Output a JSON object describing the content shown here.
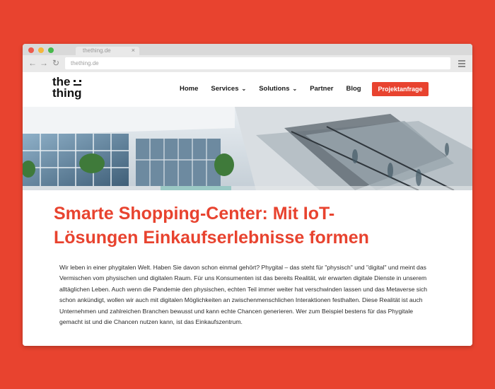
{
  "browser": {
    "tab_title": "thething.de",
    "tab_close": "×",
    "url": "thething.de",
    "back_icon": "←",
    "forward_icon": "→",
    "reload_icon": "↻"
  },
  "site": {
    "logo": {
      "line1": "the",
      "line2": "thing"
    },
    "nav": [
      {
        "label": "Home",
        "has_dropdown": false
      },
      {
        "label": "Services",
        "has_dropdown": true
      },
      {
        "label": "Solutions",
        "has_dropdown": true
      },
      {
        "label": "Partner",
        "has_dropdown": false
      },
      {
        "label": "Blog",
        "has_dropdown": false
      }
    ],
    "dropdown_icon": "⌄",
    "cta_label": "Projektanfrage",
    "accent_color": "#e8432f"
  },
  "article": {
    "headline_line1": "Smarte Shopping-Center: Mit IoT-",
    "headline_line2": "Lösungen Einkaufserlebnisse formen",
    "body": "Wir leben in einer phygitalen Welt. Haben Sie davon schon einmal gehört? Phygital – das steht für \"physisch\" und \"digital\" und meint das Vermischen vom physischen und digitalen Raum. Für uns Konsumenten ist das bereits Realität, wir erwarten digitale Dienste in unserem alltäglichen Leben. Auch wenn die Pandemie den physischen, echten Teil immer weiter hat verschwinden lassen und das Metaverse sich schon ankündigt, wollen wir auch mit digitalen Möglichkeiten an zwischenmenschlichen Interaktionen festhalten. Diese Realität ist auch Unternehmen und zahlreichen Branchen bewusst und kann echte Chancen generieren. Wer zum Beispiel bestens für das Phygitale gemacht ist und die Chancen nutzen kann, ist das Einkaufszentrum."
  }
}
